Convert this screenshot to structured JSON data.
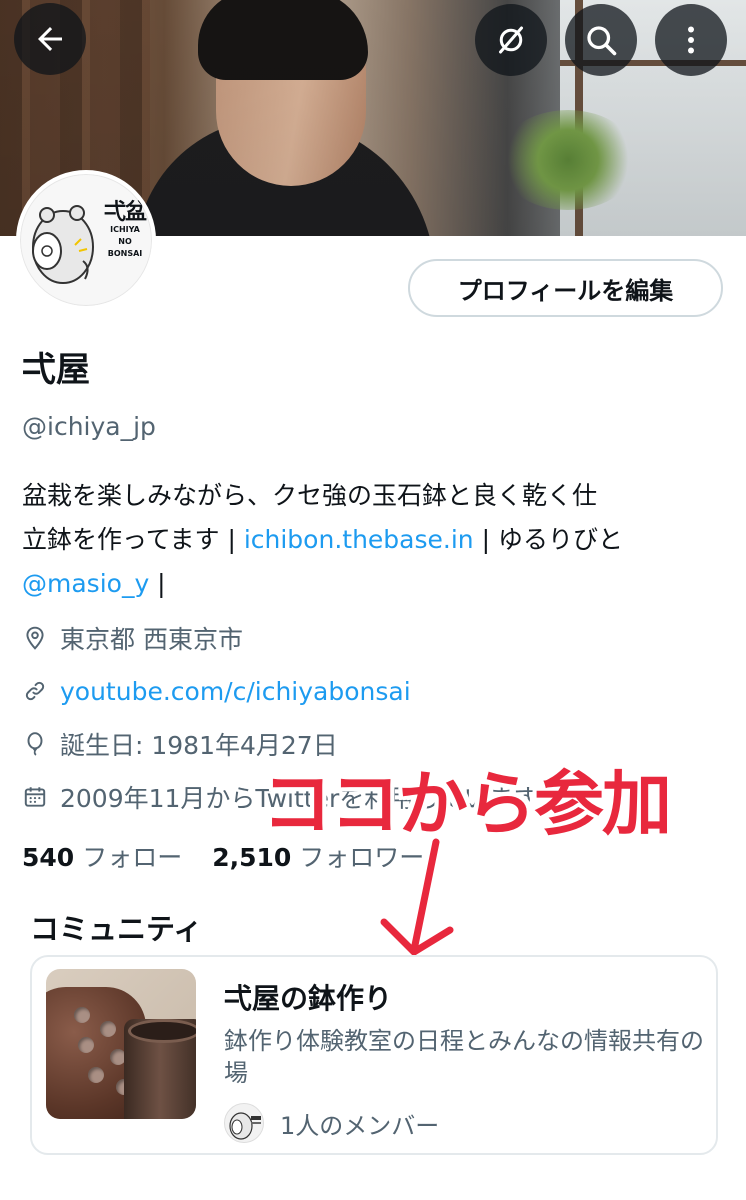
{
  "header": {
    "back_label": "back",
    "grok_label": "grok",
    "search_label": "search",
    "more_label": "more"
  },
  "avatar": {
    "logo_text": "弌盆",
    "sub_line1": "ICHIYA",
    "sub_line2": "NO",
    "sub_line3": "BONSAI"
  },
  "profile": {
    "edit_button": "プロフィールを編集",
    "name": "弌屋",
    "handle": "@ichiya_jp",
    "bio_text1": "盆栽を楽しみながら、クセ強の玉石鉢と良く乾く仕",
    "bio_text2": "立鉢を作ってます | ",
    "bio_link1": "ichibon.thebase.in",
    "bio_text3": " | ゆるりびと",
    "bio_link2": "@masio_y",
    "bio_text4": " |",
    "location": "東京都 西東京市",
    "website": "youtube.com/c/ichiyabonsai",
    "birthday": "誕生日: 1981年4月27日",
    "joined": "2009年11月からTwitterを利用しています"
  },
  "stats": {
    "following_count": "540",
    "following_label": "フォロー",
    "followers_count": "2,510",
    "followers_label": "フォロワー"
  },
  "overlay": {
    "annotation": "ココから参加"
  },
  "community": {
    "section_title": "コミュニティ",
    "name": "弌屋の鉢作り",
    "description": "鉢作り体験教室の日程とみんなの情報共有の場",
    "members": "1人のメンバー"
  },
  "colors": {
    "link": "#1d9bf0",
    "secondary_text": "#536471",
    "annotation_red": "#e8283d"
  }
}
